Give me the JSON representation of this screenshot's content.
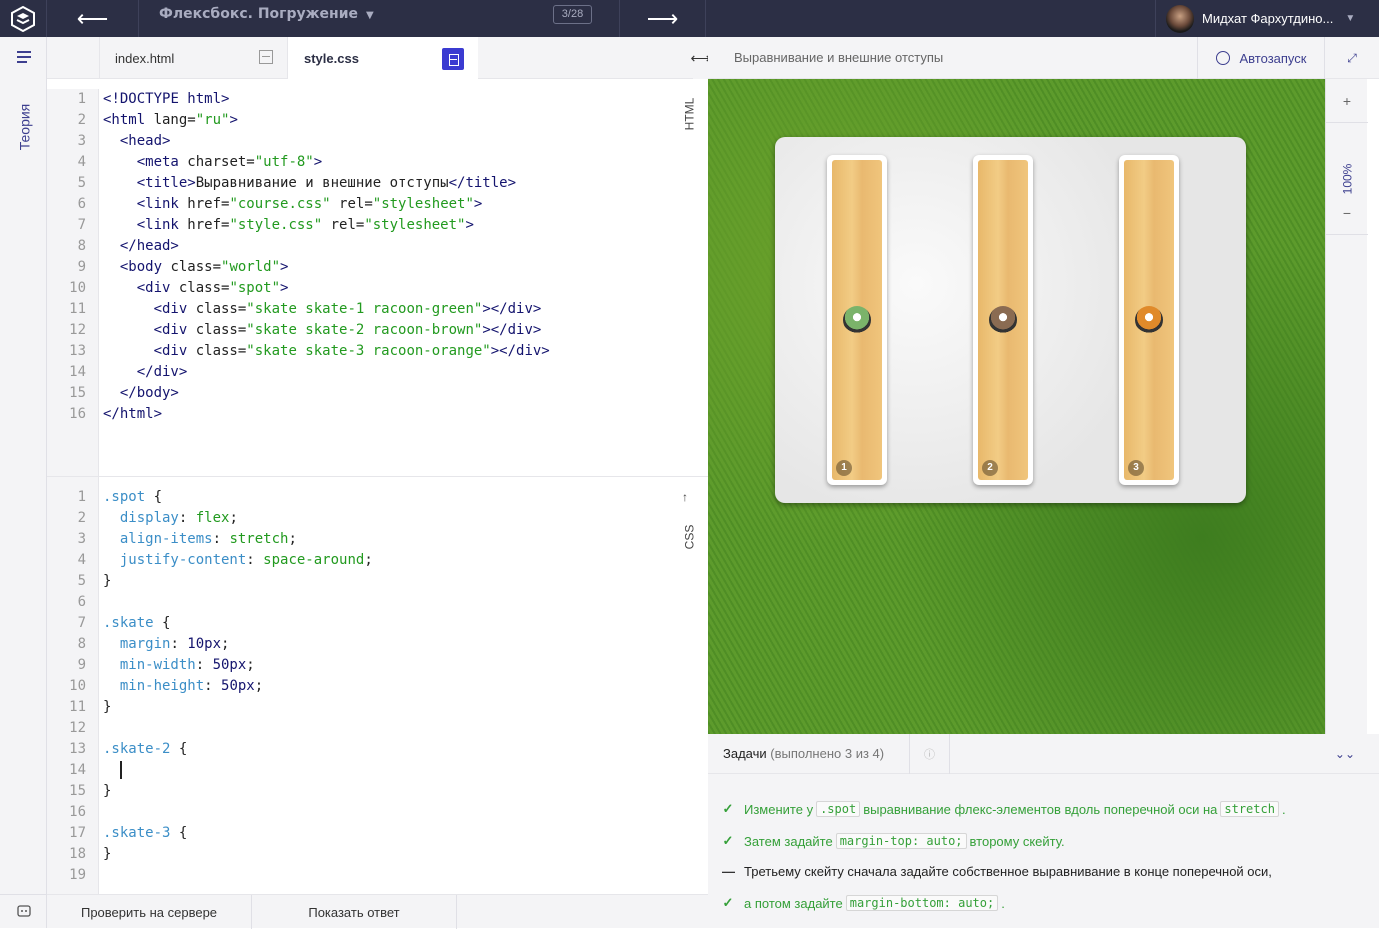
{
  "topbar": {
    "course_title": "Флексбокс. Погружение",
    "progress": "3/28",
    "user_name": "Мидхат Фархутдино..."
  },
  "sidebar": {
    "theory_label": "Теория"
  },
  "editor": {
    "tabs": [
      {
        "label": "index.html"
      },
      {
        "label": "style.css"
      }
    ],
    "html_label": "HTML",
    "css_label": "CSS",
    "html_lines": [
      [
        [
          "tg",
          "<"
        ],
        [
          "tg",
          "!DOCTYPE html>"
        ]
      ],
      [
        [
          "tg",
          "<html "
        ],
        [
          "an",
          "lang="
        ],
        [
          "av",
          "\"ru\""
        ],
        [
          "tg",
          ">"
        ]
      ],
      [
        [
          "tg",
          "  <head>"
        ]
      ],
      [
        [
          "tg",
          "    <meta "
        ],
        [
          "an",
          "charset="
        ],
        [
          "av",
          "\"utf-8\""
        ],
        [
          "tg",
          ">"
        ]
      ],
      [
        [
          "tg",
          "    <title>"
        ],
        [
          "an",
          "Выравнивание и внешние отступы"
        ],
        [
          "tg",
          "</title>"
        ]
      ],
      [
        [
          "tg",
          "    <link "
        ],
        [
          "an",
          "href="
        ],
        [
          "av",
          "\"course.css\""
        ],
        [
          "an",
          " rel="
        ],
        [
          "av",
          "\"stylesheet\""
        ],
        [
          "tg",
          ">"
        ]
      ],
      [
        [
          "tg",
          "    <link "
        ],
        [
          "an",
          "href="
        ],
        [
          "av",
          "\"style.css\""
        ],
        [
          "an",
          " rel="
        ],
        [
          "av",
          "\"stylesheet\""
        ],
        [
          "tg",
          ">"
        ]
      ],
      [
        [
          "tg",
          "  </head>"
        ]
      ],
      [
        [
          "tg",
          "  <body "
        ],
        [
          "an",
          "class="
        ],
        [
          "av",
          "\"world\""
        ],
        [
          "tg",
          ">"
        ]
      ],
      [
        [
          "tg",
          "    <div "
        ],
        [
          "an",
          "class="
        ],
        [
          "av",
          "\"spot\""
        ],
        [
          "tg",
          ">"
        ]
      ],
      [
        [
          "tg",
          "      <div "
        ],
        [
          "an",
          "class="
        ],
        [
          "av",
          "\"skate skate-1 racoon-green\""
        ],
        [
          "tg",
          "></div>"
        ]
      ],
      [
        [
          "tg",
          "      <div "
        ],
        [
          "an",
          "class="
        ],
        [
          "av",
          "\"skate skate-2 racoon-brown\""
        ],
        [
          "tg",
          "></div>"
        ]
      ],
      [
        [
          "tg",
          "      <div "
        ],
        [
          "an",
          "class="
        ],
        [
          "av",
          "\"skate skate-3 racoon-orange\""
        ],
        [
          "tg",
          "></div>"
        ]
      ],
      [
        [
          "tg",
          "    </div>"
        ]
      ],
      [
        [
          "tg",
          "  </body>"
        ]
      ],
      [
        [
          "tg",
          "</html>"
        ]
      ]
    ],
    "css_lines": [
      [
        [
          "sel",
          ".spot"
        ],
        [
          "an",
          " {"
        ]
      ],
      [
        [
          "pr",
          "  display"
        ],
        [
          "an",
          ": "
        ],
        [
          "vl",
          "flex"
        ],
        [
          "an",
          ";"
        ]
      ],
      [
        [
          "pr",
          "  align-items"
        ],
        [
          "an",
          ": "
        ],
        [
          "vl",
          "stretch"
        ],
        [
          "an",
          ";"
        ]
      ],
      [
        [
          "pr",
          "  justify-content"
        ],
        [
          "an",
          ": "
        ],
        [
          "vl",
          "space-around"
        ],
        [
          "an",
          ";"
        ]
      ],
      [
        [
          "an",
          "}"
        ]
      ],
      [],
      [
        [
          "sel",
          ".skate"
        ],
        [
          "an",
          " {"
        ]
      ],
      [
        [
          "pr",
          "  margin"
        ],
        [
          "an",
          ": "
        ],
        [
          "nm",
          "10px"
        ],
        [
          "an",
          ";"
        ]
      ],
      [
        [
          "pr",
          "  min-width"
        ],
        [
          "an",
          ": "
        ],
        [
          "nm",
          "50px"
        ],
        [
          "an",
          ";"
        ]
      ],
      [
        [
          "pr",
          "  min-height"
        ],
        [
          "an",
          ": "
        ],
        [
          "nm",
          "50px"
        ],
        [
          "an",
          ";"
        ]
      ],
      [
        [
          "an",
          "}"
        ]
      ],
      [],
      [
        [
          "sel",
          ".skate-2"
        ],
        [
          "an",
          " {"
        ]
      ],
      [
        [
          "an",
          "  "
        ],
        [
          "cursor",
          ""
        ]
      ],
      [
        [
          "an",
          "}"
        ]
      ],
      [],
      [
        [
          "sel",
          ".skate-3"
        ],
        [
          "an",
          " {"
        ]
      ],
      [
        [
          "an",
          "}"
        ]
      ],
      []
    ]
  },
  "buttons": {
    "check": "Проверить на сервере",
    "answer": "Показать ответ"
  },
  "preview": {
    "title": "Выравнивание и внешние отступы",
    "autorun": "Автозапуск",
    "zoom_in": "+",
    "zoom_level": "100%",
    "zoom_out": "−",
    "boards": [
      {
        "num": "1",
        "racoon_color": "#7bb36a"
      },
      {
        "num": "2",
        "racoon_color": "#8a6b52"
      },
      {
        "num": "3",
        "racoon_color": "#e08a2a"
      }
    ]
  },
  "tasks": {
    "label": "Задачи",
    "status": "(выполнено 3 из 4)",
    "items": [
      {
        "state": "done",
        "parts": [
          "Измените у ",
          {
            "code": ".spot"
          },
          " выравнивание флекс-элементов вдоль поперечной оси на ",
          {
            "code": "stretch"
          },
          "."
        ]
      },
      {
        "state": "done",
        "parts": [
          "Затем задайте ",
          {
            "code": "margin-top: auto;"
          },
          " второму скейту."
        ]
      },
      {
        "state": "todo",
        "parts": [
          "Третьему скейту сначала задайте собственное выравнивание в конце поперечной оси,"
        ]
      },
      {
        "state": "done",
        "parts": [
          "а потом задайте ",
          {
            "code": "margin-bottom: auto;"
          },
          "."
        ]
      }
    ]
  }
}
